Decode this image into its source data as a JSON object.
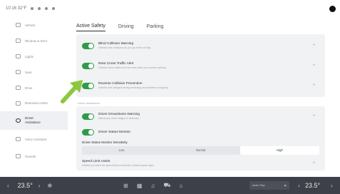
{
  "status_bar": {
    "time": "10:16 32°F"
  },
  "sidebar": {
    "items": [
      {
        "label": "Vehicle",
        "icon": "car-icon"
      },
      {
        "label": "Window & Door",
        "icon": "window-icon"
      },
      {
        "label": "Lights",
        "icon": "light-icon"
      },
      {
        "label": "Seat",
        "icon": "seat-icon"
      },
      {
        "label": "Drive",
        "icon": "steering-icon"
      },
      {
        "label": "Rearview Assist",
        "icon": "rearview-icon"
      },
      {
        "label": "Driver Assistance",
        "icon": "driver-assist-icon",
        "active": true
      },
      {
        "label": "Voice Assistant",
        "icon": "voice-icon"
      },
      {
        "label": "Sounds",
        "icon": "speaker-icon"
      }
    ]
  },
  "tabs": [
    "Active Safety",
    "Driving",
    "Parking"
  ],
  "cards": {
    "rows": [
      {
        "title": "Blind Collision Warning",
        "desc": "Detects rear collisions as you go in the vicinity"
      },
      {
        "title": "Rear Cross Traffic Alert",
        "desc": "Detects cross traffic from the rear while you reverse parking"
      },
      {
        "title": "Reverse Collision Prevention",
        "desc": "Detects rear dangers during reversing and assists in stopping"
      }
    ]
  },
  "section_label": "Driver Assistance",
  "card2": {
    "rows": [
      {
        "title": "Driver Drowsiness Warning",
        "desc": "Warns you when fatigue is detected"
      },
      {
        "title": "Driver Status Monitor",
        "desc": ""
      }
    ],
    "sensitivity_title": "Driver Status Monitor Sensitivity",
    "sensitivity_options": [
      "Low",
      "Normal",
      "High"
    ],
    "selected": "High",
    "speed_title": "Speed Limit Assist",
    "speed_desc": "Notifies you when the speed limit is exceeded. Detects speed signs"
  },
  "bottom_bar": {
    "temp_left": "23.5°",
    "temp_right": "23.5°",
    "media_label": "Audio Stop"
  },
  "colors": {
    "toggle_on": "#2e9b4a",
    "arrow": "#8dc63f",
    "bottom_bar": "#3d4048"
  }
}
